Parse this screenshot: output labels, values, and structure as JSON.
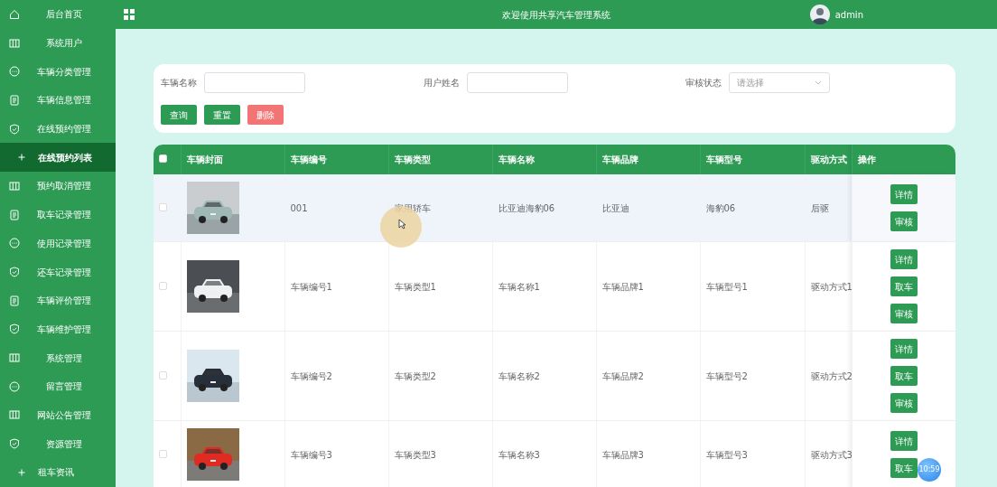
{
  "sidebar": {
    "items": [
      {
        "label": "后台首页",
        "kind": "home",
        "selected": false
      },
      {
        "label": "系统用户",
        "kind": "columns",
        "selected": false
      },
      {
        "label": "车辆分类管理",
        "kind": "chat",
        "selected": false
      },
      {
        "label": "车辆信息管理",
        "kind": "document",
        "selected": false
      },
      {
        "label": "在线预约管理",
        "kind": "shield",
        "selected": false
      },
      {
        "label": "在线预约列表",
        "kind": "plus",
        "selected": true
      },
      {
        "label": "预约取消管理",
        "kind": "columns",
        "selected": false
      },
      {
        "label": "取车记录管理",
        "kind": "document",
        "selected": false
      },
      {
        "label": "使用记录管理",
        "kind": "chat",
        "selected": false
      },
      {
        "label": "还车记录管理",
        "kind": "shield",
        "selected": false
      },
      {
        "label": "车辆评价管理",
        "kind": "document",
        "selected": false
      },
      {
        "label": "车辆维护管理",
        "kind": "shield",
        "selected": false
      },
      {
        "label": "系统管理",
        "kind": "columns",
        "selected": false
      },
      {
        "label": "留言管理",
        "kind": "chat",
        "selected": false
      },
      {
        "label": "网站公告管理",
        "kind": "columns",
        "selected": false
      },
      {
        "label": "资源管理",
        "kind": "shield",
        "selected": false
      },
      {
        "label": "租车资讯",
        "kind": "plus",
        "selected": false
      }
    ]
  },
  "header": {
    "title": "欢迎使用共享汽车管理系统",
    "user": "admin"
  },
  "search": {
    "fields": [
      {
        "label": "车辆名称",
        "kind": "input"
      },
      {
        "label": "用户姓名",
        "kind": "input"
      },
      {
        "label": "审核状态",
        "kind": "select",
        "placeholder": "请选择"
      }
    ],
    "buttons": [
      {
        "label": "查询",
        "kind": "primary"
      },
      {
        "label": "重置",
        "kind": "primary"
      },
      {
        "label": "删除",
        "kind": "danger"
      }
    ]
  },
  "table": {
    "header_checked": false,
    "columns": [
      "车辆封面",
      "车辆编号",
      "车辆类型",
      "车辆名称",
      "车辆品牌",
      "车辆型号",
      "驱动方式",
      "操作"
    ],
    "rows": [
      {
        "checked": false,
        "hovered": true,
        "cover": {
          "kind": "picture"
        },
        "cells": [
          "",
          "001",
          "家用轿车",
          "比亚迪海豹06",
          "比亚迪",
          "海豹06",
          "后驱"
        ],
        "actions": [
          "详情",
          "审核"
        ]
      },
      {
        "checked": false,
        "hovered": false,
        "cover": {
          "kind": "picture"
        },
        "cells": [
          "",
          "车辆编号1",
          "车辆类型1",
          "车辆名称1",
          "车辆品牌1",
          "车辆型号1",
          "驱动方式1"
        ],
        "actions": [
          "详情",
          "取车",
          "审核"
        ]
      },
      {
        "checked": false,
        "hovered": false,
        "cover": {
          "kind": "picture"
        },
        "cells": [
          "",
          "车辆编号2",
          "车辆类型2",
          "车辆名称2",
          "车辆品牌2",
          "车辆型号2",
          "驱动方式2"
        ],
        "actions": [
          "详情",
          "取车",
          "审核"
        ]
      },
      {
        "checked": false,
        "hovered": false,
        "cover": {
          "kind": "picture"
        },
        "cells": [
          "",
          "车辆编号3",
          "车辆类型3",
          "车辆名称3",
          "车辆品牌3",
          "车辆型号3",
          "驱动方式3"
        ],
        "actions": [
          "详情",
          "取车"
        ]
      }
    ]
  },
  "clock_badge": "10:59"
}
